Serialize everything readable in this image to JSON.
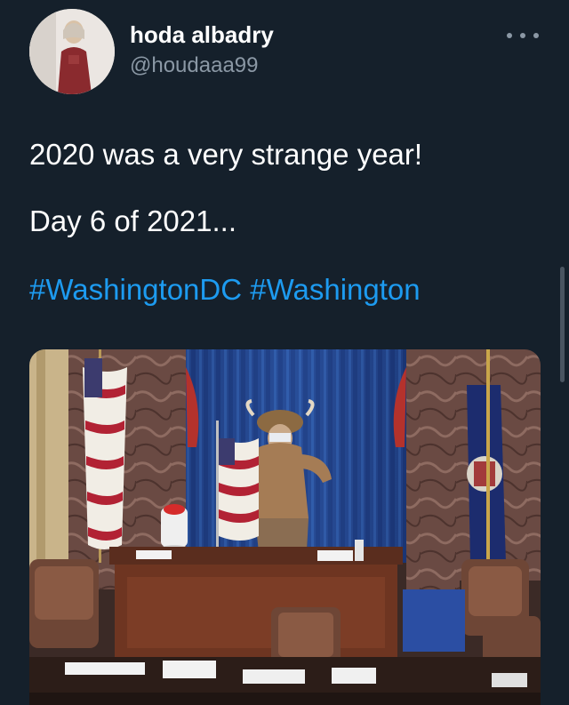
{
  "tweet": {
    "author": {
      "display_name": "hoda albadry",
      "handle": "@houdaaa99",
      "avatar_icon": "user-avatar-photo"
    },
    "menu_icon": "more-horizontal-icon",
    "text_lines": [
      "2020 was a very strange year!",
      "Day 6 of 2021..."
    ],
    "hashtags": [
      "#WashingtonDC",
      "#Washington"
    ],
    "media": {
      "type": "photo"
    }
  },
  "colors": {
    "background": "#15202b",
    "text_primary": "#ffffff",
    "text_secondary": "#8b98a5",
    "link": "#1d9bf0"
  }
}
